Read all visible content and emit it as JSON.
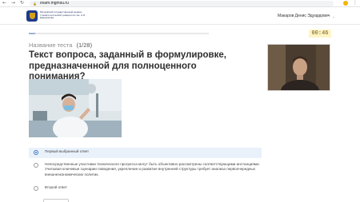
{
  "browser": {
    "back_icon": "back-arrow-icon",
    "forward_icon": "forward-arrow-icon",
    "reload_icon": "reload-icon",
    "url": "exam.mgmsu.ru",
    "menu_icon": "more-vert-icon"
  },
  "header": {
    "logo_text": "Московский государственный медико-стоматологический университет им. А.И. Евдокимова",
    "user_name": "Макаров Денис Эдуардович"
  },
  "test": {
    "progress": 0.036,
    "timer": "00:46",
    "name": "Название теста",
    "counter": "(1/28)",
    "question": "Текст вопроса, заданный в формулировке, предназначенной для полноценного понимания?"
  },
  "answers": [
    {
      "label": "Первый выбранный ответ",
      "selected": true
    },
    {
      "label": "Непосредственные участники технического прогресса могут быть объективно рассмотрены соответствующими инстанциями. Учитывая ключевые сценарии поведения, укрепление и развитие внутренней структуры требует анализа первоочередных внешнеэкономических политик.",
      "selected": false
    },
    {
      "label": "Второй ответ",
      "selected": false
    }
  ],
  "colors": {
    "accent": "#3b73c5",
    "selected_bg": "#e9f1fb",
    "timer_bg": "#fff4c4"
  }
}
